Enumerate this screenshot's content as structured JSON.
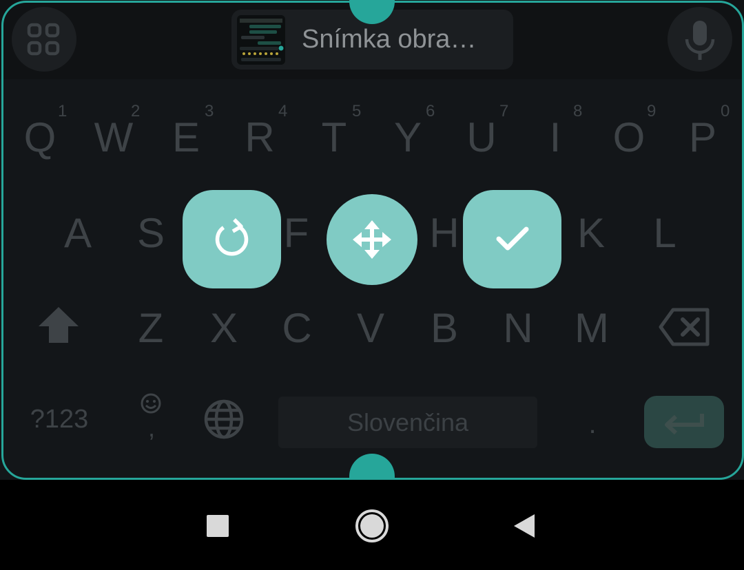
{
  "toolbar": {
    "apps_icon": "grid-icon",
    "clipboard_suggestion": "Snímka obra…",
    "mic_icon": "microphone-icon"
  },
  "keyboard": {
    "row1": [
      {
        "letter": "Q",
        "hint": "1"
      },
      {
        "letter": "W",
        "hint": "2"
      },
      {
        "letter": "E",
        "hint": "3"
      },
      {
        "letter": "R",
        "hint": "4"
      },
      {
        "letter": "T",
        "hint": "5"
      },
      {
        "letter": "Y",
        "hint": "6"
      },
      {
        "letter": "U",
        "hint": "7"
      },
      {
        "letter": "I",
        "hint": "8"
      },
      {
        "letter": "O",
        "hint": "9"
      },
      {
        "letter": "P",
        "hint": "0"
      }
    ],
    "row2": [
      "A",
      "S",
      "F",
      "H",
      "K",
      "L"
    ],
    "row3": [
      "Z",
      "X",
      "C",
      "V",
      "B",
      "N",
      "M"
    ],
    "symbols_key": "?123",
    "space_label": "Slovenčina",
    "period_key": ".",
    "comma_key": ","
  },
  "resize_mode": {
    "actions": [
      "reset-icon",
      "move-icon",
      "check-icon"
    ],
    "accent_color": "#26a69a",
    "button_color": "#80cbc4"
  },
  "navbar": {
    "buttons": [
      "recents-icon",
      "home-icon",
      "back-icon"
    ]
  }
}
